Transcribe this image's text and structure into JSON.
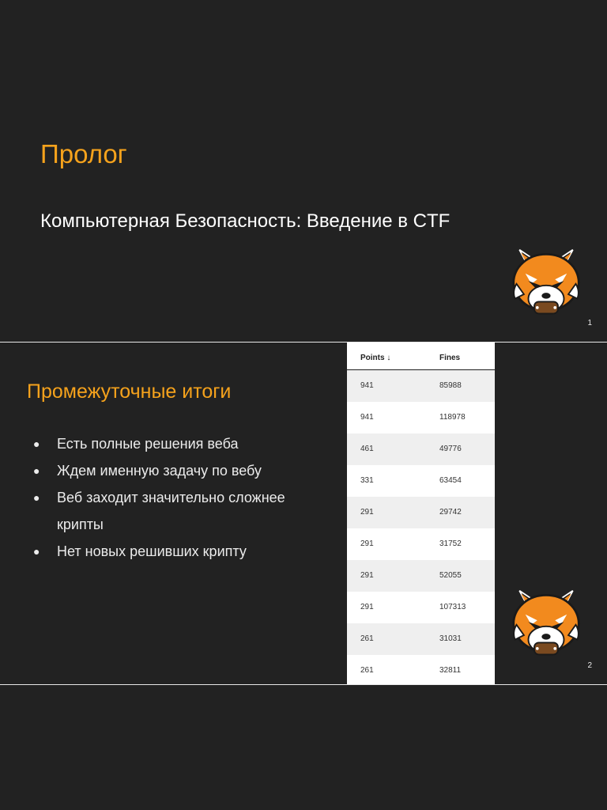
{
  "slide1": {
    "title": "Пролог",
    "subtitle": "Компьютерная Безопасность: Введение в CTF",
    "page_number": "1"
  },
  "slide2": {
    "title": "Промежуточные итоги",
    "bullets": [
      "Есть полные решения веба",
      "Ждем именную задачу по вебу",
      "Веб заходит значительно сложнее крипты",
      "Нет новых решивших крипту"
    ],
    "page_number": "2",
    "table": {
      "headers": [
        "Points ↓",
        "Fines"
      ],
      "rows": [
        [
          "941",
          "85988"
        ],
        [
          "941",
          "118978"
        ],
        [
          "461",
          "49776"
        ],
        [
          "331",
          "63454"
        ],
        [
          "291",
          "29742"
        ],
        [
          "291",
          "31752"
        ],
        [
          "291",
          "52055"
        ],
        [
          "291",
          "107313"
        ],
        [
          "261",
          "31031"
        ],
        [
          "261",
          "32811"
        ]
      ]
    }
  },
  "colors": {
    "background": "#222222",
    "accent": "#f5a21c",
    "text": "#ffffff"
  },
  "icons": [
    "red-panda-logo-icon"
  ]
}
